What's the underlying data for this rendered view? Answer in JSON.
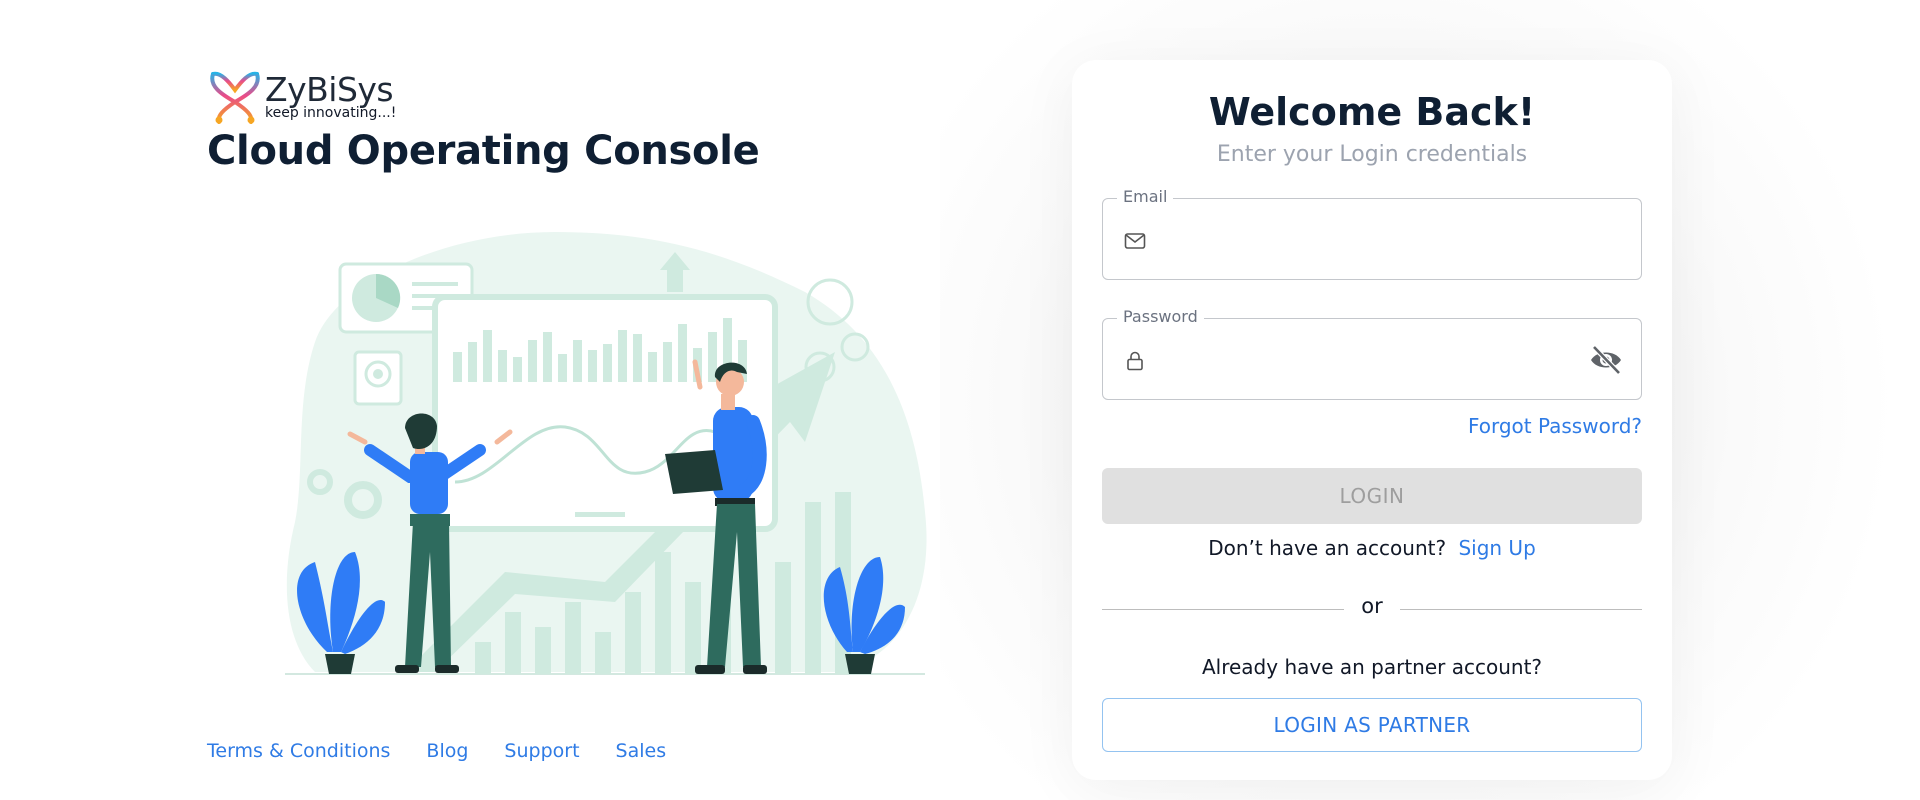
{
  "brand": {
    "name": "ZyBiSys",
    "tagline": "keep innovating...!",
    "console_title": "Cloud Operating Console"
  },
  "footer": {
    "links": [
      "Terms & Conditions",
      "Blog",
      "Support",
      "Sales"
    ]
  },
  "login": {
    "heading": "Welcome Back!",
    "subheading": "Enter your Login credentials",
    "email": {
      "label": "Email",
      "value": "",
      "icon": "mail-icon"
    },
    "password": {
      "label": "Password",
      "value": "",
      "icon": "lock-icon",
      "toggle_icon": "eye-off-icon"
    },
    "forgot_label": "Forgot Password?",
    "login_label": "LOGIN",
    "no_account_text": "Don’t have an account?",
    "signup_label": "Sign Up",
    "or_text": "or",
    "partner_question": "Already have an partner account?",
    "partner_button_label": "LOGIN AS PARTNER"
  },
  "colors": {
    "link": "#2f7be5",
    "heading": "#0f1f33",
    "illustration_mint": "#cfeadf",
    "illustration_blue": "#2f7cf6",
    "illustration_green": "#2e6b5e",
    "disabled_button": "#e0e0e0"
  }
}
